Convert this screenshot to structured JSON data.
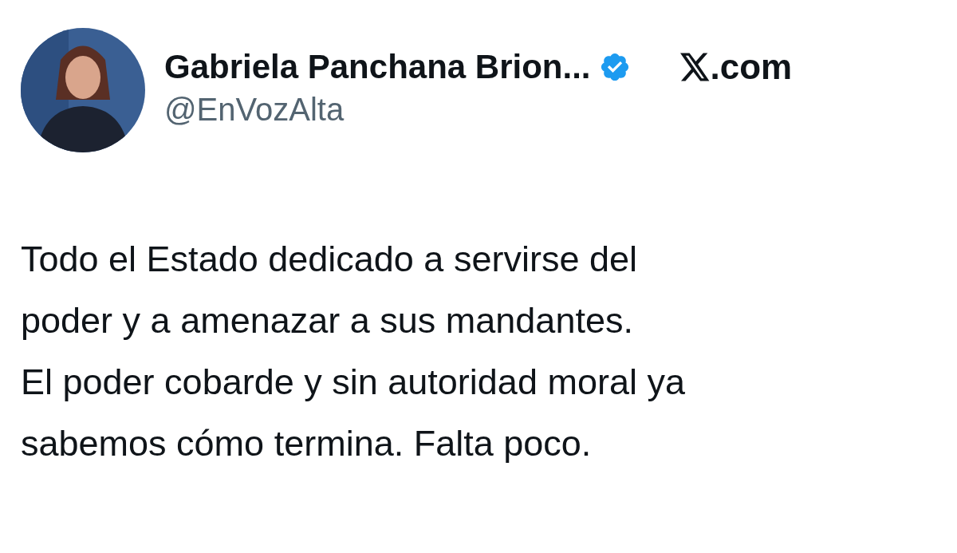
{
  "author": {
    "name": "Gabriela Panchana Brion...",
    "verified": true,
    "handle": "@EnVozAlta"
  },
  "site": {
    "domain": ".com"
  },
  "post": {
    "lines": [
      "Todo el Estado dedicado a servirse del",
      "poder y a amenazar a sus mandantes.",
      "El poder cobarde y sin autoridad moral ya",
      "sabemos cómo termina. Falta poco."
    ]
  }
}
